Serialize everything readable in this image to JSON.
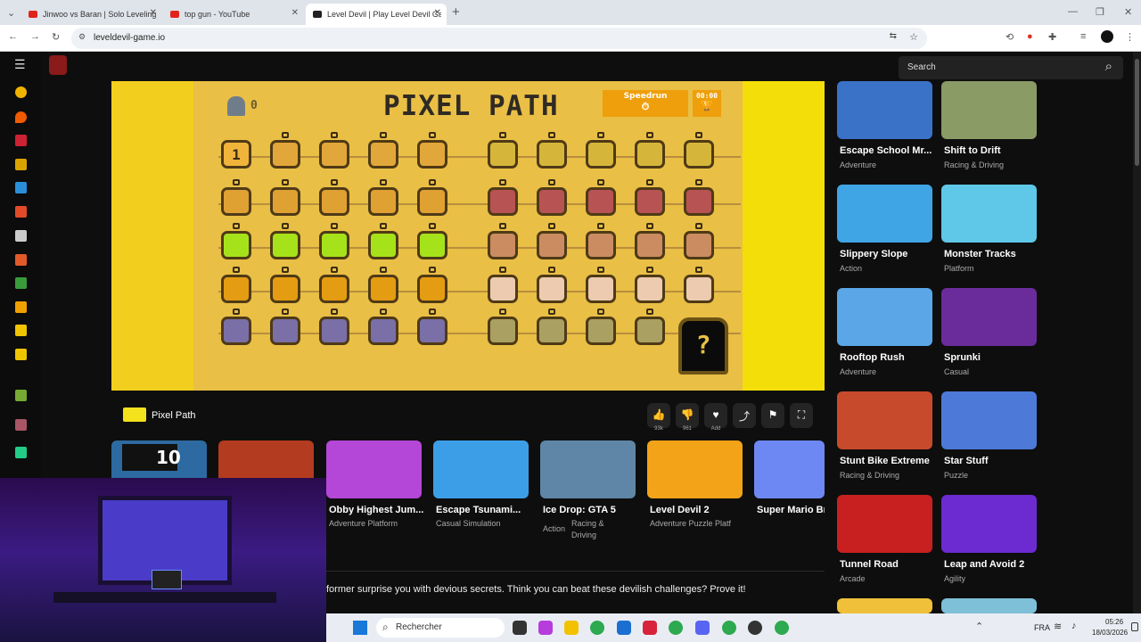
{
  "browser": {
    "tabs": [
      {
        "title": "Jinwoo vs Baran | Solo Leveling",
        "fav": "#e0241c"
      },
      {
        "title": "top gun - YouTube",
        "fav": "#e0241c"
      },
      {
        "title": "Level Devil | Play Level Devil Ga",
        "fav": "#222",
        "active": true
      }
    ],
    "url": "leveldevil-game.io",
    "new_tab": "+"
  },
  "site": {
    "search_placeholder": "Search",
    "game": {
      "title": "PIXEL PATH",
      "score": "0",
      "speedrun_label": "Speedrun",
      "timer": "00:00",
      "first_level": "1",
      "mystery": "?"
    },
    "game_name": "Pixel Path",
    "actions": [
      {
        "icon": "👍",
        "sub": "93k"
      },
      {
        "icon": "👎",
        "sub": "961"
      },
      {
        "icon": "♥",
        "sub": "Add"
      },
      {
        "icon": "⤴",
        "sub": ""
      },
      {
        "icon": "⚑",
        "sub": ""
      },
      {
        "icon": "⛶",
        "sub": ""
      }
    ],
    "related": [
      {
        "title": "",
        "tags": "",
        "color": "#2d6aa1"
      },
      {
        "title": "",
        "tags": "",
        "color": "#b33b1f"
      },
      {
        "title": "Obby Highest Jum...",
        "tags": "Adventure   Platform",
        "color": "#b447d8"
      },
      {
        "title": "Escape Tsunami...",
        "tags": "Casual   Simulation",
        "color": "#3d9ee8"
      },
      {
        "title": "Ice Drop: GTA 5",
        "tags": "Action",
        "tags2": "Racing &",
        "tags3": "Driving",
        "color": "#5f86a6"
      },
      {
        "title": "Level Devil 2",
        "tags": "Adventure   Puzzle   Platf",
        "color": "#f2a318"
      },
      {
        "title": "Super Mario Bro",
        "tags": "",
        "color": "#6d88f2"
      }
    ],
    "description": "former surprise you with devious secrets. Think you can beat these devilish challenges? Prove it!",
    "sidebar_games": [
      {
        "title": "Escape School Mr...",
        "tag": "Adventure",
        "color": "#3a72c8"
      },
      {
        "title": "Shift to Drift",
        "tag": "Racing & Driving",
        "color": "#8a9b66"
      },
      {
        "title": "Slippery Slope",
        "tag": "Action",
        "color": "#3fa5e5"
      },
      {
        "title": "Monster Tracks",
        "tag": "Platform",
        "color": "#5fc7e7"
      },
      {
        "title": "Rooftop Rush",
        "tag": "Adventure",
        "color": "#5ba6e6"
      },
      {
        "title": "Sprunki",
        "tag": "Casual",
        "color": "#6a2c9b"
      },
      {
        "title": "Stunt Bike Extreme",
        "tag": "Racing & Driving",
        "color": "#c84a2c"
      },
      {
        "title": "Star Stuff",
        "tag": "Puzzle",
        "color": "#4d7ad8"
      },
      {
        "title": "Tunnel Road",
        "tag": "Arcade",
        "color": "#c82020"
      },
      {
        "title": "Leap and Avoid 2",
        "tag": "Agility",
        "color": "#6c2bd0"
      }
    ],
    "related_badge": "10"
  },
  "taskbar": {
    "search": "Rechercher",
    "lang": "FRA",
    "time": "05:26",
    "date": "18/03/2026"
  }
}
